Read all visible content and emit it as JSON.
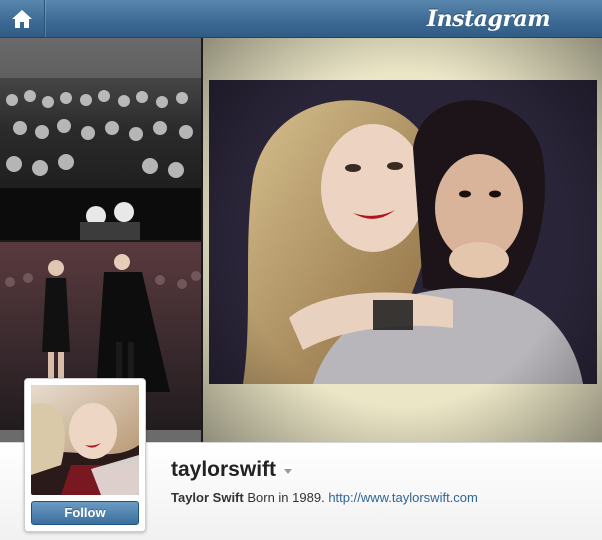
{
  "header": {
    "brand": "Instagram",
    "home_icon": "home-icon"
  },
  "mosaic": {
    "photos": [
      {
        "alt": "concert crowd photo"
      },
      {
        "alt": "runway photo"
      },
      {
        "alt": "friends hug photo"
      }
    ]
  },
  "profile": {
    "username": "taylorswift",
    "full_name": "Taylor Swift",
    "bio": "Born in 1989.",
    "website": "http://www.taylorswift.com",
    "follow_label": "Follow"
  },
  "colors": {
    "topbar": "#3e6b95",
    "link": "#2f6596",
    "follow": "#3b6f9c"
  }
}
